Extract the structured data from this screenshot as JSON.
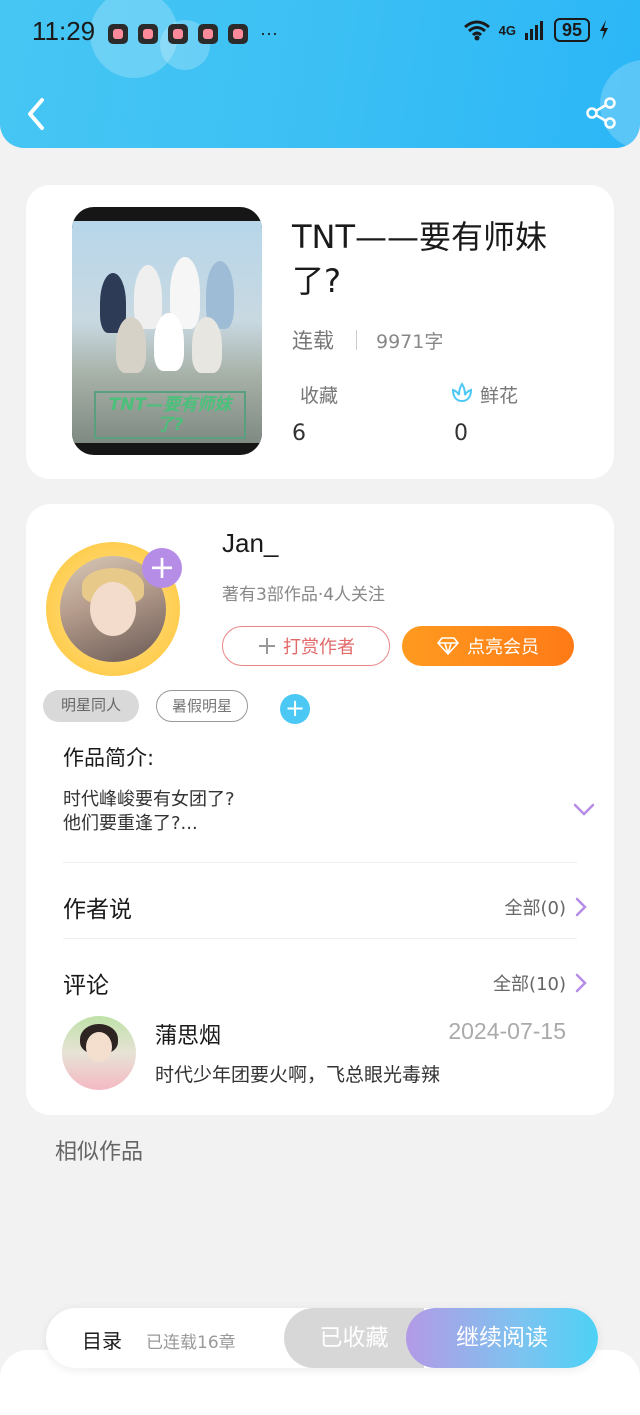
{
  "status_bar": {
    "time": "11:29",
    "more": "···",
    "network": "4G",
    "battery": "95"
  },
  "book": {
    "cover_text": "TNT—要有师妹了?",
    "title": "TNT——要有师妹了?",
    "status": "连载",
    "word_count": "9971字",
    "collect_label": "收藏",
    "collect_value": "6",
    "flower_label": "鲜花",
    "flower_value": "0"
  },
  "author": {
    "name": "Jan_",
    "meta": "著有3部作品·4人关注",
    "reward_label": "打赏作者",
    "vip_label": "点亮会员",
    "follow_plus": "+"
  },
  "tags": [
    "明星同人",
    "暑假明星"
  ],
  "tag_add": "+",
  "intro": {
    "label": "作品简介:",
    "text": "时代峰峻要有女团了?\n他们要重逢了?..."
  },
  "author_says": {
    "label": "作者说",
    "all": "全部(0)"
  },
  "comments": {
    "label": "评论",
    "all": "全部(10)",
    "items": [
      {
        "name": "蒲思烟",
        "date": "2024-07-15",
        "text": "时代少年团要火啊，飞总眼光毒辣"
      }
    ]
  },
  "similar_label": "相似作品",
  "bottom_bar": {
    "toc": "目录",
    "chapters": "已连载16章",
    "favorited": "已收藏",
    "continue": "继续阅读"
  },
  "colors": {
    "header": "#3cc0f4",
    "vip": "#ff8a1a",
    "reward": "#e26a6a",
    "accent_purple": "#b58de6",
    "tag_add": "#4cc8f5"
  }
}
